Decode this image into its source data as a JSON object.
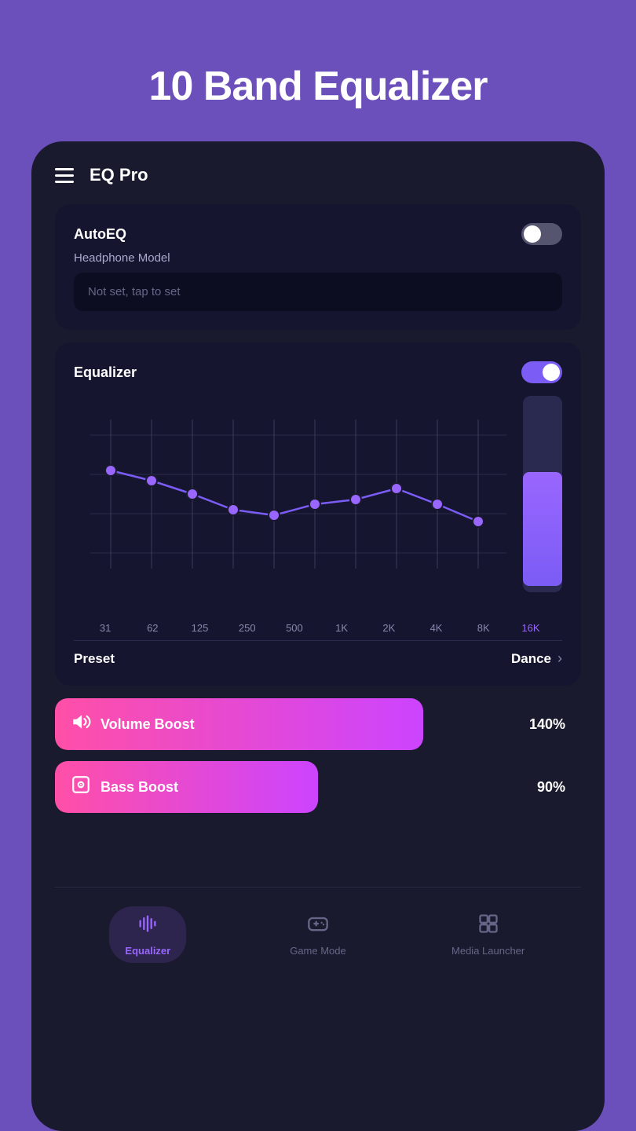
{
  "hero": {
    "title": "10 Band Equalizer"
  },
  "app": {
    "title": "EQ Pro"
  },
  "autoeq": {
    "label": "AutoEQ",
    "toggle_state": "off",
    "headphone_label": "Headphone Model",
    "headphone_placeholder": "Not set, tap to set"
  },
  "equalizer": {
    "label": "Equalizer",
    "toggle_state": "on",
    "bands": [
      {
        "freq": "31",
        "value": -2,
        "normalized": 0.38
      },
      {
        "freq": "62",
        "value": -4,
        "normalized": 0.35
      },
      {
        "freq": "125",
        "value": -7,
        "normalized": 0.3
      },
      {
        "freq": "250",
        "value": -10,
        "normalized": 0.25
      },
      {
        "freq": "500",
        "value": -11,
        "normalized": 0.23
      },
      {
        "freq": "1K",
        "value": -9,
        "normalized": 0.26
      },
      {
        "freq": "2K",
        "value": -8,
        "normalized": 0.28
      },
      {
        "freq": "4K",
        "value": -6,
        "normalized": 0.32
      },
      {
        "freq": "8K",
        "value": -9,
        "normalized": 0.26
      },
      {
        "freq": "16K",
        "value": -14,
        "normalized": 0.18
      }
    ],
    "preset_label": "Preset",
    "preset_value": "Dance"
  },
  "volume_boost": {
    "label": "Volume Boost",
    "value": "140%",
    "fill_width": "70%"
  },
  "bass_boost": {
    "label": "Bass Boost",
    "value": "90%",
    "fill_width": "50%"
  },
  "bottom_nav": {
    "items": [
      {
        "id": "equalizer",
        "label": "Equalizer",
        "active": true
      },
      {
        "id": "game-mode",
        "label": "Game Mode",
        "active": false
      },
      {
        "id": "media-launcher",
        "label": "Media Launcher",
        "active": false
      }
    ]
  },
  "colors": {
    "accent": "#7B5CF5",
    "pink": "#FF4FA7",
    "purple": "#CC44FF",
    "bg_dark": "#0d0d22",
    "bg_card": "#151530",
    "bg_phone": "#1a1a2e",
    "hero_bg": "#6B4FBB"
  }
}
